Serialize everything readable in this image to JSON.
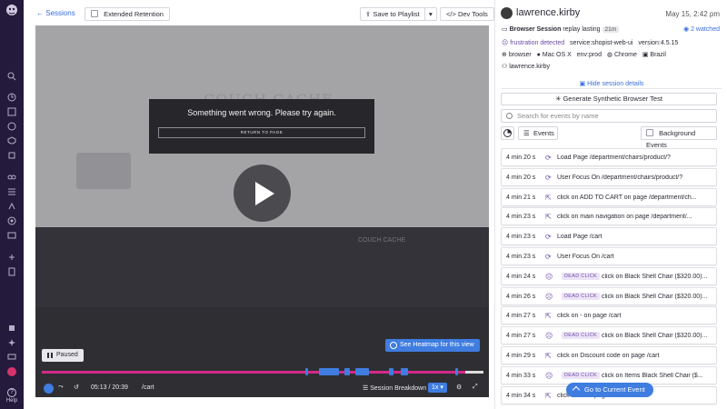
{
  "topbar": {
    "back_label": "Sessions",
    "extended_retention": "Extended Retention",
    "save_to_playlist": "Save to Playlist",
    "dev_tools": "Dev Tools"
  },
  "player": {
    "site_ghost_title": "COUCH CACHE",
    "site_ghost_footer": "COUCH CACHE",
    "error_message": "Something went wrong. Please try again.",
    "return_label": "RETURN TO PAGE",
    "heatmap_label": "See Heatmap for this view",
    "paused_label": "Paused",
    "time": "05:13 / 20:39",
    "path": "/cart",
    "breakdown_label": "Session Breakdown",
    "speed": "1x",
    "progress_fraction": 0.253
  },
  "panel": {
    "username": "lawrence.kirby",
    "date": "May 15, 2:42 pm",
    "session_type": "Browser Session",
    "replay_lasting": "replay lasting",
    "duration": "21m",
    "watched": "2 watched",
    "tags": {
      "frustration": "frustration detected",
      "service": "service:shopist-web-ui",
      "version": "version:4.5.15",
      "browser": "browser",
      "os": "Mac OS X",
      "env": "env:prod",
      "browser_name": "Chrome",
      "country": "Brazil",
      "user": "lawrence.kirby"
    },
    "hide_details": "Hide session details",
    "generate_test": "Generate Synthetic Browser Test",
    "search_placeholder": "Search for events by name",
    "events_label": "Events",
    "background_events": "Background Events"
  },
  "events": [
    {
      "time": "4 min 20 s",
      "icon": "load-page-icon",
      "dead": "",
      "text": "Load Page /department/chairs/product/?"
    },
    {
      "time": "4 min 20 s",
      "icon": "user-focus-icon",
      "dead": "",
      "text": "User Focus On /department/chairs/product/?"
    },
    {
      "time": "4 min 21 s",
      "icon": "click-icon",
      "dead": "",
      "text": "click on ADD TO CART on page /department/ch..."
    },
    {
      "time": "4 min 23 s",
      "icon": "click-icon",
      "dead": "",
      "text": "click on main navigation on page /department/..."
    },
    {
      "time": "4 min 23 s",
      "icon": "load-page-icon",
      "dead": "",
      "text": "Load Page /cart"
    },
    {
      "time": "4 min 23 s",
      "icon": "user-focus-icon",
      "dead": "",
      "text": "User Focus On /cart"
    },
    {
      "time": "4 min 24 s",
      "icon": "frustration-icon",
      "dead": "DEAD CLICK",
      "text": "click on Black Shell Chair ($320.00)..."
    },
    {
      "time": "4 min 26 s",
      "icon": "frustration-icon",
      "dead": "DEAD CLICK",
      "text": "click on Black Shell Chair ($320.00)..."
    },
    {
      "time": "4 min 27 s",
      "icon": "click-icon",
      "dead": "",
      "text": "click on - on page /cart"
    },
    {
      "time": "4 min 27 s",
      "icon": "frustration-icon",
      "dead": "DEAD CLICK",
      "text": "click on Black Shell Chair ($320.00)..."
    },
    {
      "time": "4 min 29 s",
      "icon": "click-icon",
      "dead": "",
      "text": "click on Discount code on page /cart"
    },
    {
      "time": "4 min 33 s",
      "icon": "frustration-icon",
      "dead": "DEAD CLICK",
      "text": "click on Items Black Shell Chair ($..."
    },
    {
      "time": "4 min 34 s",
      "icon": "click-icon",
      "dead": "",
      "text": "click on + on page /cart"
    }
  ],
  "goto_current": "Go to Current Event",
  "colors": {
    "accent": "#3f7de0",
    "nav": "#241a3b",
    "timeline": "#d2298b",
    "frustration": "#6b4aa6"
  },
  "nav": {
    "help": "Help"
  }
}
